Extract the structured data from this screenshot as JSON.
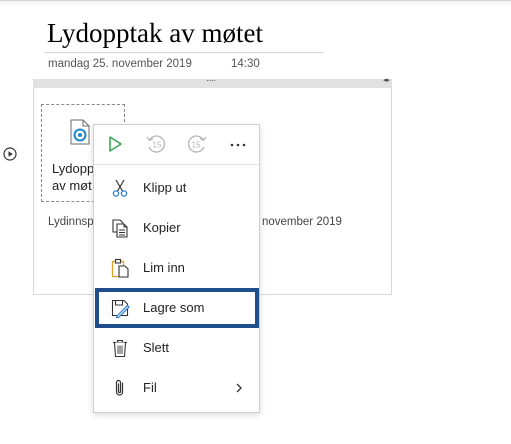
{
  "page": {
    "title": "Lydopptak av møtet",
    "date": "mandag 25. november 2019",
    "time": "14:30"
  },
  "audio": {
    "file_label_line1": "Lydoppt",
    "file_label_line2": "av møt",
    "caption_left": "Lydinnspi",
    "caption_right": "november 2019",
    "icon": "audio-file-icon"
  },
  "menu": {
    "toolbar": [
      {
        "name": "play",
        "icon": "play-icon"
      },
      {
        "name": "rewind-15",
        "icon": "rewind-15-icon",
        "label": "15"
      },
      {
        "name": "forward-15",
        "icon": "forward-15-icon",
        "label": "15"
      },
      {
        "name": "more",
        "icon": "more-icon",
        "label": "···"
      }
    ],
    "items": [
      {
        "label": "Klipp ut",
        "icon": "scissors-icon"
      },
      {
        "label": "Kopier",
        "icon": "copy-icon"
      },
      {
        "label": "Lim inn",
        "icon": "paste-icon"
      },
      {
        "label": "Lagre som",
        "icon": "save-as-icon",
        "highlighted": true
      },
      {
        "label": "Slett",
        "icon": "trash-icon"
      },
      {
        "label": "Fil",
        "icon": "paperclip-icon",
        "submenu": true
      }
    ]
  },
  "colors": {
    "highlight": "#1f4e8c",
    "play": "#3aa655",
    "audio_accent": "#1e88c8",
    "paste_accent": "#e0a030"
  }
}
